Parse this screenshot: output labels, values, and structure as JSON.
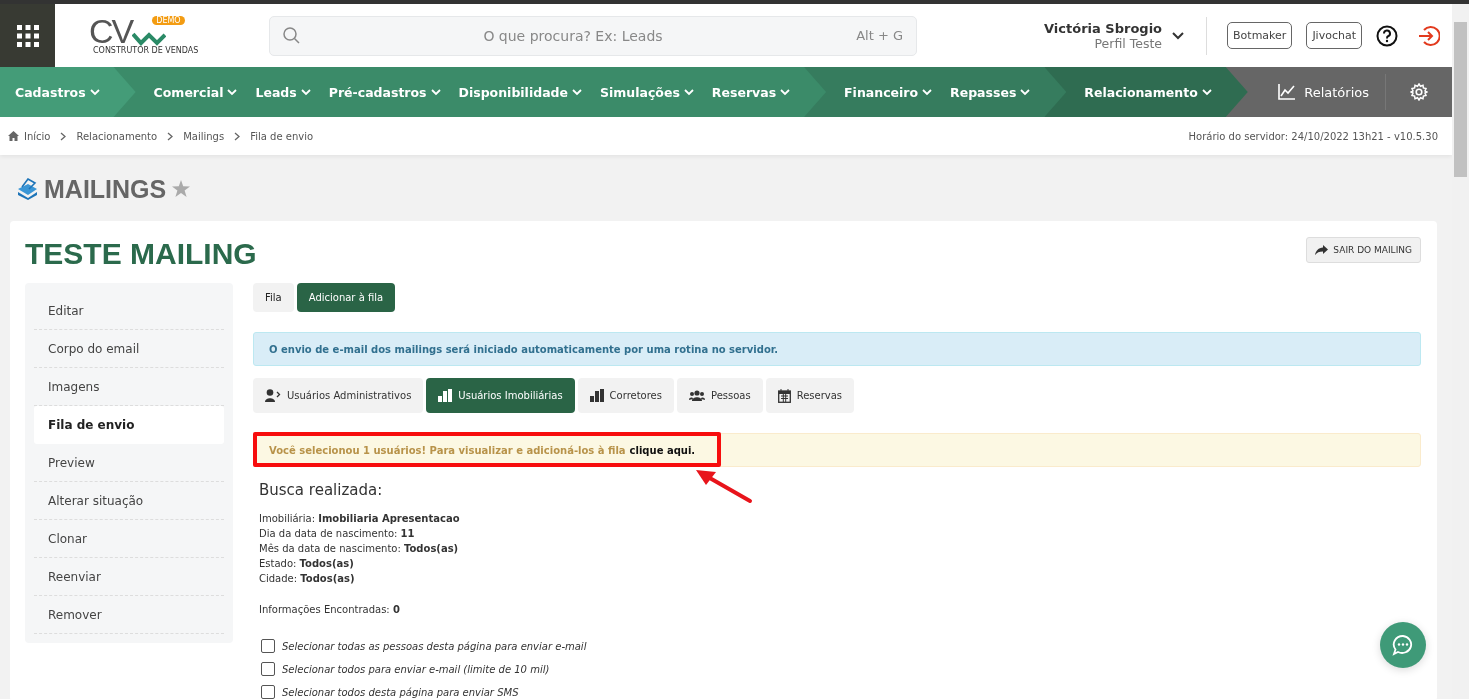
{
  "header": {
    "logo": {
      "mark": "CV",
      "badge": "DEMO",
      "tagline": "CONSTRUTOR DE VENDAS"
    },
    "search": {
      "placeholder": "O que procura? Ex: Leads",
      "shortcut": "Alt + G"
    },
    "user": {
      "name": "Victória Sbrogio",
      "profile": "Perfil Teste"
    },
    "buttons": [
      "Botmaker",
      "Jivochat"
    ]
  },
  "nav": {
    "groups": [
      {
        "items": [
          "Cadastros"
        ]
      },
      {
        "items": [
          "Comercial",
          "Leads",
          "Pré-cadastros",
          "Disponibilidade",
          "Simulações",
          "Reservas"
        ]
      },
      {
        "items": [
          "Financeiro",
          "Repasses"
        ]
      },
      {
        "items": [
          "Relacionamento"
        ]
      }
    ],
    "reports": "Relatórios"
  },
  "breadcrumb": {
    "items": [
      "Início",
      "Relacionamento",
      "Mailings",
      "Fila de envio"
    ],
    "server_time": "Horário do servidor: 24/10/2022 13h21 - v10.5.30"
  },
  "page_title": "MAILINGS",
  "card": {
    "title": "TESTE MAILING",
    "exit_button": "SAIR DO MAILING",
    "sidebar": [
      {
        "label": "Editar",
        "selected": false
      },
      {
        "label": "Corpo do email",
        "selected": false
      },
      {
        "label": "Imagens",
        "selected": false
      },
      {
        "label": "Fila de envio",
        "selected": true
      },
      {
        "label": "Preview",
        "selected": false
      },
      {
        "label": "Alterar situação",
        "selected": false
      },
      {
        "label": "Clonar",
        "selected": false
      },
      {
        "label": "Reenviar",
        "selected": false
      },
      {
        "label": "Remover",
        "selected": false
      }
    ],
    "tabs": [
      {
        "label": "Fila",
        "selected": false
      },
      {
        "label": "Adicionar à fila",
        "selected": true
      }
    ],
    "info": "O envio de e-mail dos mailings será iniciado automaticamente por uma rotina no servidor.",
    "audience_tabs": [
      {
        "kind": "admin",
        "label": "Usuários Administrativos",
        "selected": false
      },
      {
        "kind": "agency",
        "label": "Usuários Imobiliárias",
        "selected": true
      },
      {
        "kind": "broker",
        "label": "Corretores",
        "selected": false
      },
      {
        "kind": "people",
        "label": "Pessoas",
        "selected": false
      },
      {
        "kind": "calendar",
        "label": "Reservas",
        "selected": false
      }
    ],
    "alert": {
      "text": "Você selecionou 1 usuários! Para visualizar e adicioná-los à fila",
      "link": "clique aqui."
    },
    "search_title": "Busca realizada:",
    "filters": [
      "Imobiliária: **Imobiliaria Apresentacao**",
      "Dia da data de nascimento: **11**",
      "Mês da data de nascimento: **Todos(as)**",
      "Estado: **Todos(as)**",
      "Cidade: **Todos(as)**"
    ],
    "found": "Informações Encontradas: **0**",
    "options": [
      {
        "label": "Selecionar todas as pessoas desta página para enviar e-mail",
        "checked": false
      },
      {
        "label": "Selecionar todos para enviar e-mail (limite de 10 mil)",
        "checked": false
      },
      {
        "label": "Selecionar todos desta página para enviar SMS",
        "checked": false
      }
    ]
  }
}
